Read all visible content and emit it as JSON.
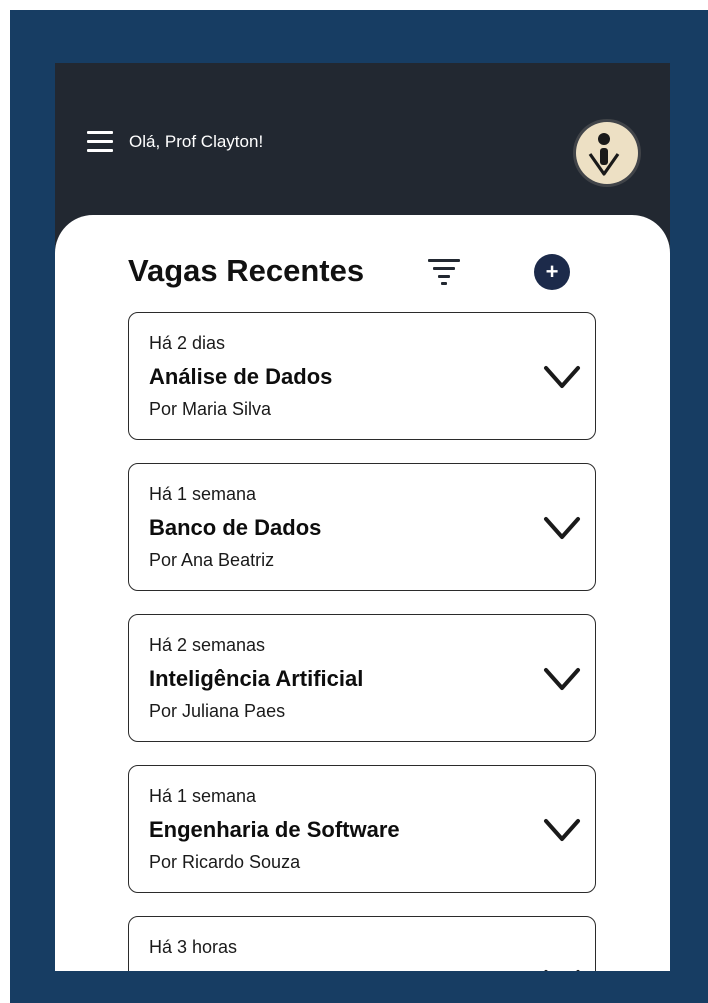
{
  "header": {
    "greeting": "Olá, Prof Clayton!"
  },
  "main": {
    "title": "Vagas Recentes",
    "add_label": "+",
    "cards": [
      {
        "time": "Há 2 dias",
        "name": "Análise de Dados",
        "author": "Por Maria Silva"
      },
      {
        "time": "Há 1 semana",
        "name": "Banco de Dados",
        "author": "Por Ana Beatriz"
      },
      {
        "time": "Há 2 semanas",
        "name": "Inteligência Artificial",
        "author": "Por Juliana Paes"
      },
      {
        "time": "Há 1 semana",
        "name": "Engenharia de Software",
        "author": "Por Ricardo Souza"
      },
      {
        "time": "Há 3 horas",
        "name": "",
        "author": ""
      }
    ]
  },
  "icons": {
    "menu": "menu-icon",
    "filter": "filter-icon",
    "add": "plus-icon",
    "expand": "chevron-down-icon",
    "avatar": "avatar-logo"
  },
  "colors": {
    "outer_background": "#173d63",
    "app_bar": "#222831",
    "content_background": "#ffffff",
    "add_button": "#1c2a4a",
    "avatar_background": "#ede0c4"
  }
}
